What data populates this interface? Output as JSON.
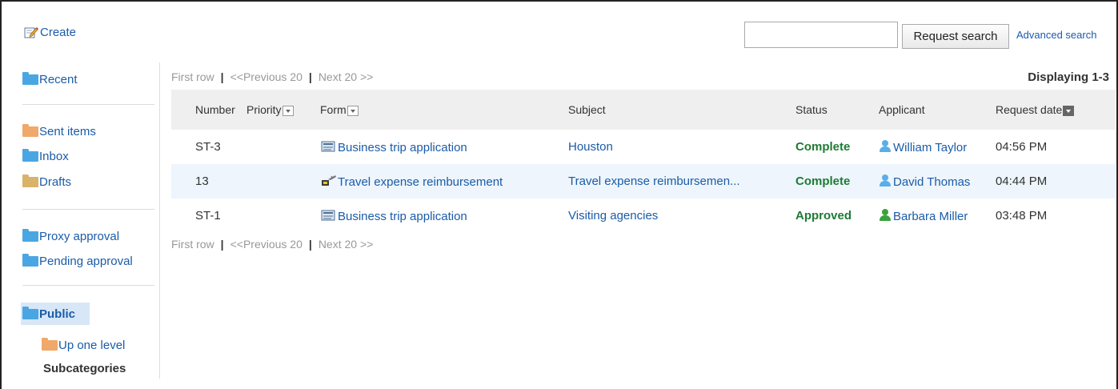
{
  "toolbar": {
    "create_label": "Create",
    "search_value": "",
    "search_placeholder": "",
    "search_button": "Request search",
    "advanced_search": "Advanced search"
  },
  "sidebar": {
    "recent": "Recent",
    "sent_items": "Sent items",
    "inbox": "Inbox",
    "drafts": "Drafts",
    "proxy_approval": "Proxy approval",
    "pending_approval": "Pending approval",
    "public": "Public",
    "up_one_level": "Up one level",
    "subcategories": "Subcategories"
  },
  "pager": {
    "first_row": "First row",
    "previous": "<<Previous 20",
    "next": "Next 20 >>",
    "separator": "|",
    "displaying": "Displaying 1-3"
  },
  "table": {
    "columns": [
      "Number",
      "Priority",
      "Form",
      "Subject",
      "Status",
      "Applicant",
      "Request date"
    ],
    "rows": [
      {
        "number": "ST-3",
        "form": "Business trip application",
        "subject": "Houston",
        "status": "Complete",
        "applicant": "William Taylor",
        "date": "04:56 PM"
      },
      {
        "number": "13",
        "form": "Travel expense reimbursement",
        "subject": "Travel expense reimbursemen...",
        "status": "Complete",
        "applicant": "David Thomas",
        "date": "04:44 PM"
      },
      {
        "number": "ST-1",
        "form": "Business trip application",
        "subject": "Visiting agencies",
        "status": "Approved",
        "applicant": "Barbara Miller",
        "date": "03:48 PM"
      }
    ]
  },
  "colors": {
    "link": "#1a5ca8",
    "status_green": "#1e7b34",
    "row_highlight": "#eef5fc",
    "header_bg": "#efefef",
    "selected_folder_bg": "#d7e7f7"
  },
  "icons": {
    "create": "pencil-note-icon",
    "folder": "folder-icon",
    "form": "form-icon",
    "user": "user-icon",
    "sort": "sort-dropdown-icon"
  }
}
